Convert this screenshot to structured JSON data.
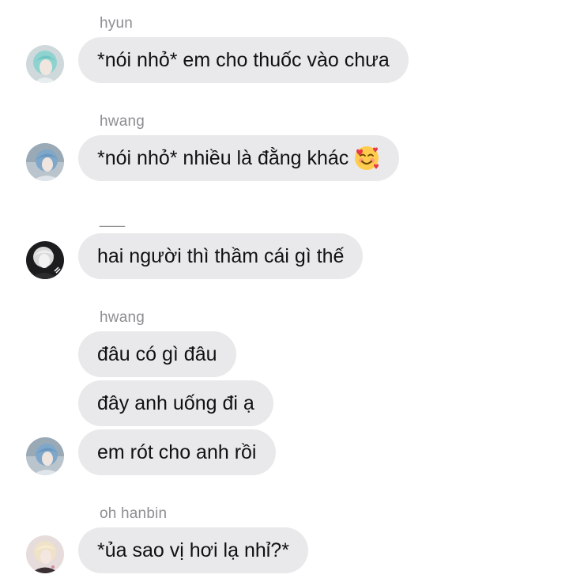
{
  "conversation": {
    "groups": [
      {
        "sender": "hyun",
        "messages": [
          "*nói nhỏ* em cho thuốc vào chưa"
        ],
        "avatar_icon": "user-avatar-teal-hair"
      },
      {
        "sender": "hwang",
        "messages": [
          "*nói nhỏ* nhiều là đằng khác"
        ],
        "emoji": "smiling-face-with-hearts-emoji",
        "avatar_icon": "user-avatar-blue-hair"
      },
      {
        "sender": "___",
        "messages": [
          "hai người thì thầm cái gì thế"
        ],
        "avatar_icon": "user-avatar-dark"
      },
      {
        "sender": "hwang",
        "messages": [
          "đâu có gì đâu",
          "đây anh uống đi ạ",
          "em rót cho anh rồi"
        ],
        "avatar_icon": "user-avatar-blue-hair"
      },
      {
        "sender": "oh hanbin",
        "messages": [
          "*ủa sao vị hơi lạ nhỉ?*"
        ],
        "avatar_icon": "user-avatar-blond-hair"
      }
    ]
  },
  "colors": {
    "bubble": "#e9e9eb",
    "sender_name": "#8e8e93",
    "text": "#111111",
    "background": "#ffffff"
  }
}
